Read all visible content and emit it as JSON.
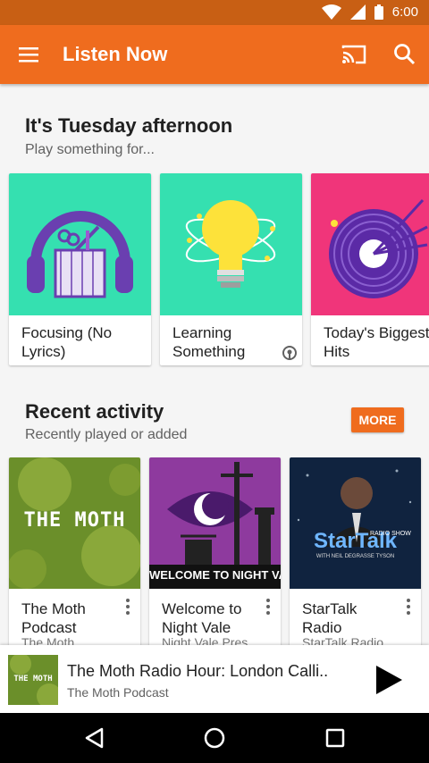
{
  "status_bar": {
    "time": "6:00"
  },
  "app_bar": {
    "title": "Listen Now",
    "icons": [
      "menu-icon",
      "cast-icon",
      "search-icon"
    ]
  },
  "suggestions": {
    "title": "It's Tuesday afternoon",
    "subtitle": "Play something for...",
    "cards": [
      {
        "label": "Focusing (No Lyrics)"
      },
      {
        "label": "Learning Something"
      },
      {
        "label": "Today's Biggest Hits"
      }
    ]
  },
  "recent": {
    "title": "Recent activity",
    "subtitle": "Recently played or added",
    "more_label": "MORE",
    "cards": [
      {
        "title": "The Moth Podcast",
        "sub": "The Moth",
        "art_text": "THE MOTH"
      },
      {
        "title": "Welcome to Night Vale",
        "sub": "Night Vale Pres",
        "art_text": "WELCOME TO NIGHT VALE"
      },
      {
        "title": "StarTalk Radio",
        "sub": "StarTalk Radio",
        "art_text": "StarTalk",
        "art_sub": "RADIO SHOW",
        "art_host": "WITH NEIL DEGRASSE TYSON"
      }
    ]
  },
  "now_playing": {
    "title": "The Moth Radio Hour: London Calli..",
    "subtitle": "The Moth Podcast",
    "art_text": "THE MOTH"
  },
  "colors": {
    "accent": "#ef6c1e",
    "status": "#c85f14"
  }
}
